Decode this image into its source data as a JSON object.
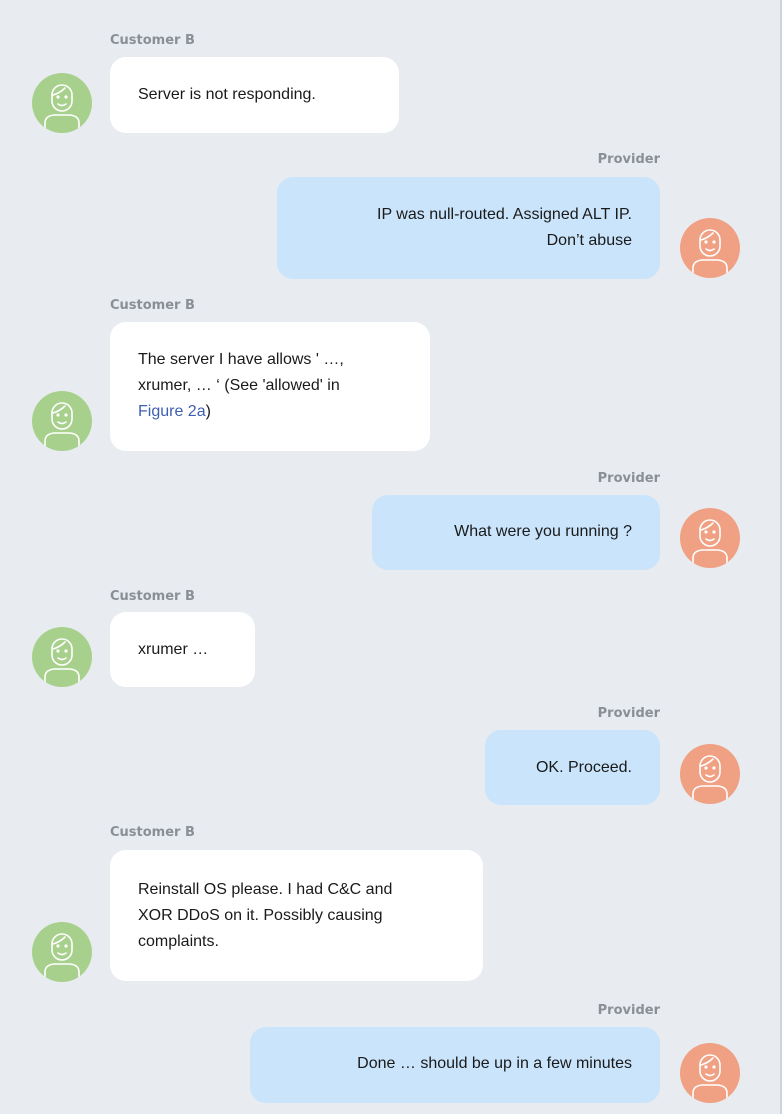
{
  "messages": [
    {
      "sender": "Customer B",
      "side": "left",
      "lines": [
        "Server is not responding."
      ]
    },
    {
      "sender": "Provider",
      "side": "right",
      "lines": [
        "IP was null-routed. Assigned ALT IP.",
        "Don’t abuse"
      ]
    },
    {
      "sender": "Customer B",
      "side": "left",
      "lines": [
        "The server I have allows ' …,",
        "xrumer, … ‘ (See 'allowed' in"
      ],
      "link_text": "Figure 2a",
      "link_suffix": ")"
    },
    {
      "sender": "Provider",
      "side": "right",
      "lines": [
        "What were you running ?"
      ]
    },
    {
      "sender": "Customer B",
      "side": "left",
      "lines": [
        "xrumer …"
      ]
    },
    {
      "sender": "Provider",
      "side": "right",
      "lines": [
        "OK. Proceed."
      ]
    },
    {
      "sender": "Customer B",
      "side": "left",
      "lines": [
        "Reinstall OS please. I had C&C and",
        "XOR DDoS on it. Possibly causing",
        "complaints."
      ]
    },
    {
      "sender": "Provider",
      "side": "right",
      "lines": [
        "Done … should be up in a few minutes"
      ]
    }
  ],
  "avatars": {
    "customer_color": "#a8d08d",
    "provider_color": "#f0a083",
    "icon": "person-outline-icon"
  }
}
